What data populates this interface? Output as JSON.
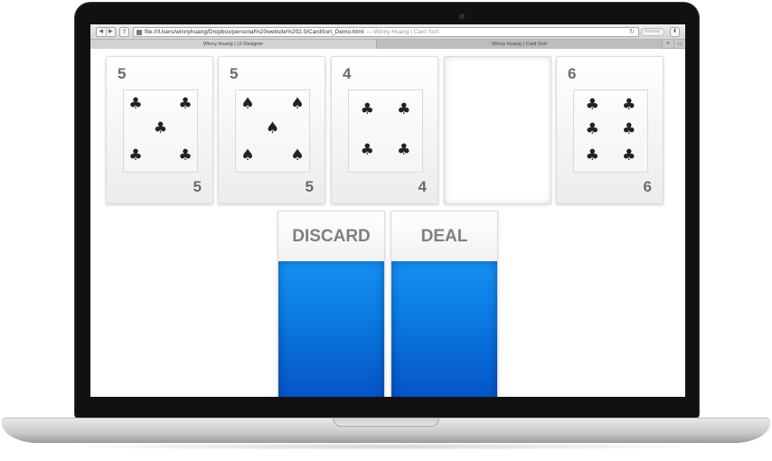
{
  "browser": {
    "url": "file:///Users/winnyhuang/Dropbox/personal%20website%202.0/CardSort_Demo.html",
    "page_title_suffix": "— Winny Huang | Card Sort",
    "reader_label": "Reader",
    "tabs": [
      {
        "label": "Winny Huang | UI Designer"
      },
      {
        "label": "Winny Huang | Card Sort"
      }
    ],
    "nav_back": "◀",
    "nav_forward": "▶",
    "share_glyph": "⇪",
    "reload_glyph": "↻",
    "download_glyph": "⬇",
    "new_tab_glyph": "+",
    "tabs_overview_glyph": "▭"
  },
  "cards": [
    {
      "rank": "5",
      "suit": "clubs",
      "suit_glyph": "♣",
      "pip_count": 5
    },
    {
      "rank": "5",
      "suit": "spades",
      "suit_glyph": "♠",
      "pip_count": 5
    },
    {
      "rank": "4",
      "suit": "clubs",
      "suit_glyph": "♣",
      "pip_count": 4
    },
    {
      "rank": "",
      "suit": "",
      "suit_glyph": "",
      "pip_count": 0,
      "empty": true
    },
    {
      "rank": "6",
      "suit": "clubs",
      "suit_glyph": "♣",
      "pip_count": 6
    }
  ],
  "piles": {
    "discard_label": "DISCARD",
    "deal_label": "DEAL"
  },
  "colors": {
    "pile_blue": "#0a77de",
    "rank_gray": "#6b6b6b"
  }
}
